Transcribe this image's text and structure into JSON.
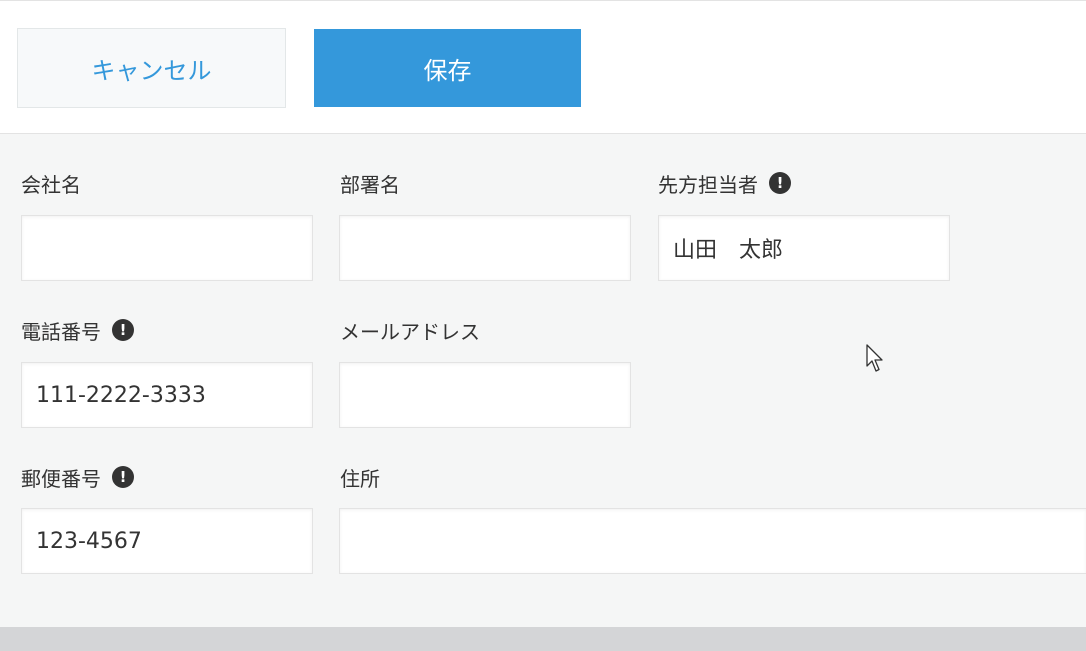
{
  "toolbar": {
    "cancel_label": "キャンセル",
    "save_label": "保存"
  },
  "form": {
    "company": {
      "label": "会社名",
      "value": ""
    },
    "department": {
      "label": "部署名",
      "value": ""
    },
    "contact_person": {
      "label": "先方担当者",
      "value": "山田　太郎",
      "required_icon": "exclamation-circle-icon"
    },
    "phone": {
      "label": "電話番号",
      "value": "111-2222-3333",
      "required_icon": "exclamation-circle-icon"
    },
    "email": {
      "label": "メールアドレス",
      "value": ""
    },
    "postal_code": {
      "label": "郵便番号",
      "value": "123-4567",
      "required_icon": "exclamation-circle-icon"
    },
    "address": {
      "label": "住所",
      "value": ""
    }
  },
  "icons": {
    "required": "!"
  },
  "colors": {
    "accent": "#3498db",
    "background": "#f5f6f6",
    "text": "#333333"
  }
}
